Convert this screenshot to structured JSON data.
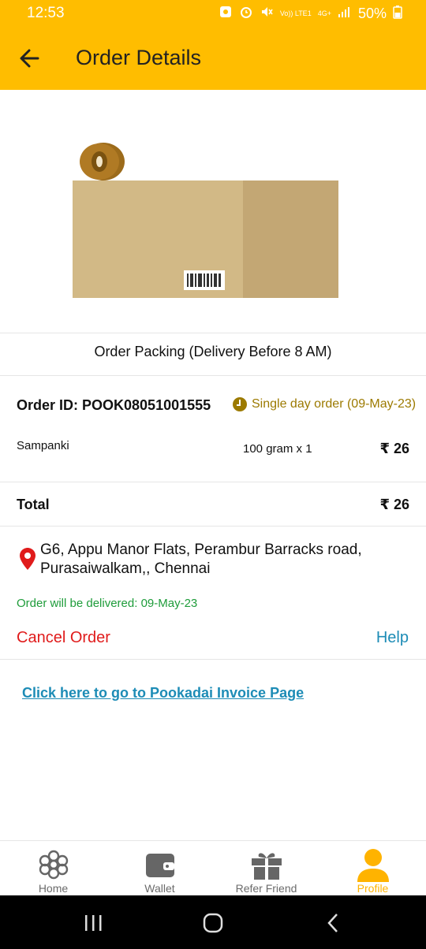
{
  "status_bar": {
    "time": "12:53",
    "network_top": "Vo)) LTE1",
    "network_type": "4G+",
    "battery": "50%"
  },
  "app_bar": {
    "title": "Order Details",
    "back_icon": "arrow-left-icon"
  },
  "hero_image": {
    "icon": "package-box-illustration"
  },
  "order": {
    "packing_status": "Order Packing (Delivery Before 8 AM)",
    "id_text": "Order ID: POOK08051001555",
    "schedule_text": "Single day order (09-May-23)",
    "items": [
      {
        "name": "Sampanki",
        "quantity": "100 gram x 1",
        "price": "₹ 26"
      }
    ],
    "total_label": "Total",
    "total_value": "₹ 26",
    "address_line1": "G6, Appu Manor Flats, Perambur Barracks road,",
    "address_line2": "Purasaiwalkam,, Chennai",
    "delivery_text": "Order will be delivered: 09-May-23",
    "cancel_label": "Cancel Order",
    "help_label": "Help",
    "invoice_link": "Click here to go to Pookadai Invoice Page"
  },
  "bottom_nav": [
    {
      "label": "Home",
      "icon": "flower-icon",
      "active": false
    },
    {
      "label": "Wallet",
      "icon": "wallet-icon",
      "active": false
    },
    {
      "label": "Refer Friend",
      "icon": "gift-icon",
      "active": false
    },
    {
      "label": "Profile",
      "icon": "person-icon",
      "active": true
    }
  ],
  "colors": {
    "app_bar": "#FFBD00",
    "schedule": "#9C7A00",
    "cancel": "#E01B1B",
    "link": "#1D8CB6",
    "delivered": "#1E9C3A",
    "active_nav": "#FFB300"
  }
}
